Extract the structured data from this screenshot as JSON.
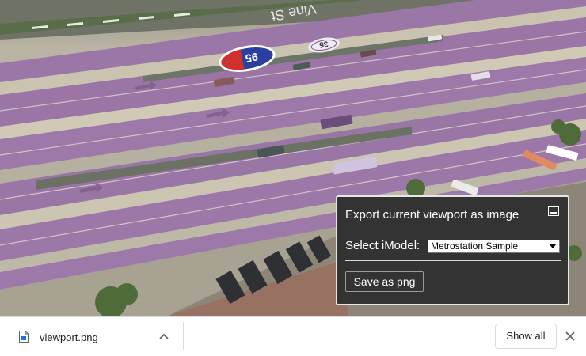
{
  "viewport": {
    "map_labels": {
      "highway_shield": "95",
      "route_marker": "35",
      "street_text": "Vine St"
    },
    "colors": {
      "ground": "#b8b3a2",
      "lane_highlight": "#9a74a6",
      "shield_blue": "#2b3f9e",
      "shield_red": "#d0312d"
    }
  },
  "export_widget": {
    "title": "Export current viewport as image",
    "minimize_icon": "minimize-icon",
    "select_label": "Select iModel:",
    "selected_model": "Metrostation Sample",
    "save_button": "Save as png"
  },
  "download_bar": {
    "file_icon": "file-icon",
    "file_name": "viewport.png",
    "chevron_icon": "chevron-up-icon",
    "show_all": "Show all",
    "close_icon": "close-icon"
  }
}
